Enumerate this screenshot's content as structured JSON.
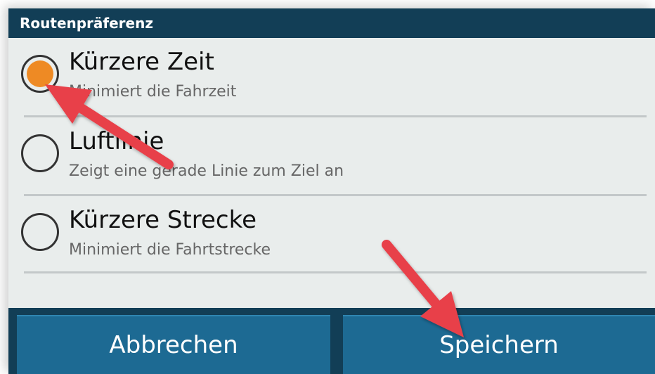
{
  "dialog": {
    "title": "Routenpräferenz",
    "options": [
      {
        "label": "Kürzere Zeit",
        "description": "Minimiert die Fahrzeit",
        "selected": true
      },
      {
        "label": "Luftlinie",
        "description": "Zeigt eine gerade Linie zum Ziel an",
        "selected": false
      },
      {
        "label": "Kürzere Strecke",
        "description": "Minimiert die Fahrtstrecke",
        "selected": false
      }
    ],
    "buttons": {
      "cancel": "Abbrechen",
      "save": "Speichern"
    }
  },
  "colors": {
    "header": "#123e56",
    "button": "#1d6a93",
    "background": "#e9edec",
    "radio_selected": "#ee8a24",
    "annotation_arrow": "#e8404a"
  },
  "annotations": [
    {
      "name": "arrow-to-selected-radio",
      "icon": "annotation-arrow"
    },
    {
      "name": "arrow-to-save-button",
      "icon": "annotation-arrow"
    }
  ]
}
